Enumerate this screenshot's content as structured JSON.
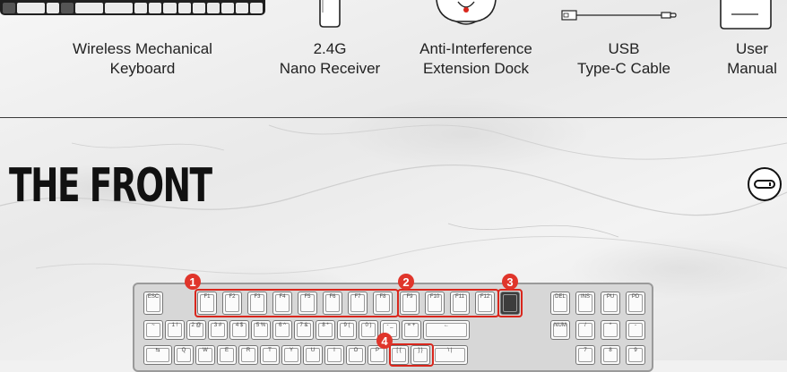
{
  "accessories": [
    {
      "label_line1": "Wireless Mechanical",
      "label_line2": "Keyboard"
    },
    {
      "label_line1": "2.4G",
      "label_line2": "Nano Receiver"
    },
    {
      "label_line1": "Anti-Interference",
      "label_line2": "Extension Dock"
    },
    {
      "label_line1": "USB",
      "label_line2": "Type-C Cable"
    },
    {
      "label_line1": "User",
      "label_line2": "Manual"
    }
  ],
  "section": {
    "title": "THE FRONT",
    "switch_icon": "power-switch-icon"
  },
  "keyboard": {
    "keys_row1": [
      "ESC",
      "F1",
      "F2",
      "F3",
      "F4",
      "F5",
      "F6",
      "F7",
      "F8",
      "F9",
      "F10",
      "F11",
      "F12",
      "",
      "DEL",
      "INS",
      "PU",
      "PD"
    ],
    "keys_row2": [
      "~",
      "1 !",
      "2 @",
      "3 #",
      "4 $",
      "5 %",
      "6 ^",
      "7 &",
      "8 *",
      "9 (",
      "0 )",
      "- _",
      "= +",
      "←",
      "NUM",
      "/",
      "*",
      "-"
    ],
    "keys_row3": [
      "⇆",
      "Q",
      "W",
      "E",
      "R",
      "T",
      "Y",
      "U",
      "I",
      "O",
      "P",
      "[ {",
      "] }",
      "\\ |",
      "7",
      "8",
      "9"
    ],
    "callouts": [
      "1",
      "2",
      "3",
      "4"
    ],
    "highlight_color": "#d9261c",
    "badge_color": "#e0352b"
  }
}
